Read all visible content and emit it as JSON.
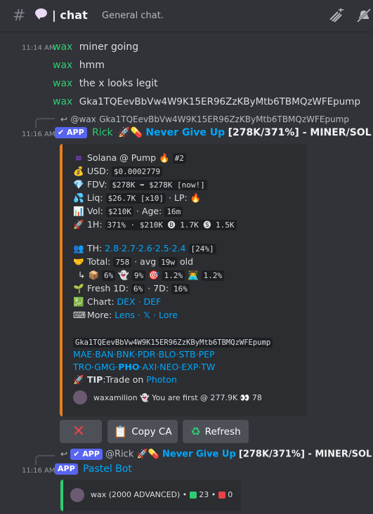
{
  "header": {
    "title": "chat",
    "topic": "General chat."
  },
  "messages": [
    {
      "time": "11:14 AM",
      "author": "wax",
      "text": "miner going"
    },
    {
      "author": "wax",
      "text": "hmm"
    },
    {
      "author": "wax",
      "text": "the x looks legit"
    },
    {
      "author": "wax",
      "text": "Gka1TQEevBbVw4W9K15ER96ZzKByMtb6TBMQzWFEpump"
    }
  ],
  "reply1": {
    "user": "@wax",
    "text": "Gka1TQEevBbVw4W9K15ER96ZzKByMtb6TBMQzWFEpump"
  },
  "bot_msg": {
    "time": "11:16 AM",
    "badge": "APP",
    "author": "Rick",
    "title_link": "Never Give Up",
    "title_rest": "[278K/371%] - MINER/SOL"
  },
  "embed": {
    "l1_name": "Solana @ Pump",
    "l1_code": "#2",
    "l2_label": "USD:",
    "l2_code": "$0.0002779",
    "l3_label": "FDV:",
    "l3_code": "$278K ➡ $278K [now!]",
    "l4_label": "Liq:",
    "l4_code": "$26.7K [x10]",
    "l4_lp": "· LP:",
    "l5_label": "Vol:",
    "l5_code": "$210K",
    "l5_age": "· Age:",
    "l5_age_code": "16m",
    "l6_label": "1H:",
    "l6_code": "371% · $210K 🅑 1.7K 🅢 1.5K",
    "th_label": "TH:",
    "th_links": "2.8·2.7·2.6·2.5·2.4",
    "th_code": "[24%]",
    "total_label": "Total:",
    "total_code": "758",
    "total_avg": "· avg",
    "total_avg_code": "19w",
    "total_old": "old",
    "sub_code1": "6%",
    "sub_code2": "9%",
    "sub_code3": "1.2%",
    "sub_code4": "1.2%",
    "fresh_label": "Fresh 1D:",
    "fresh_code1": "6%",
    "fresh_7d": "· 7D:",
    "fresh_code2": "16%",
    "chart_label": "Chart:",
    "chart_links": "DEX · DEF",
    "more_label": "More:",
    "more_links": "Lens · 𝕏 · Lore",
    "address": "Gka1TQEevBbVw4W9K15ER96ZzKByMtb6TBMQzWFEpump",
    "dex_row1": "MAE·BAN·BNK·PDR·BLO·STB·PEP",
    "dex_row2a": "TRO·GMG·",
    "dex_row2b": "PHO",
    "dex_row2c": "·AXI·NEO·EXP·TW",
    "tip_label": "TIP",
    "tip_text": ":Trade on",
    "tip_link": "Photon",
    "footer_user": "waxamilion",
    "footer_text": "You are first @ 277.9K",
    "footer_count": "78"
  },
  "buttons": {
    "cancel": "",
    "copy": "Copy CA",
    "refresh": "Refresh"
  },
  "reply2": {
    "badge": "APP",
    "user": "@Rick",
    "link": "Never Give Up",
    "rest": "[278K/371%] - MINER/SOL"
  },
  "bot2": {
    "time": "11:16 AM",
    "badge": "APP",
    "author": "Pastel Bot",
    "embed_user": "wax (2000 ADVANCED) •",
    "green_count": "23 •",
    "red_count": "0"
  }
}
